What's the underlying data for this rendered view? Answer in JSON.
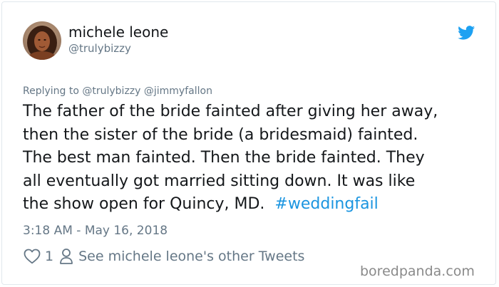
{
  "author": {
    "name": "michele leone",
    "handle": "@trulybizzy",
    "avatar": "profile-photo"
  },
  "icons": {
    "platform": "twitter-bird-icon",
    "like": "heart-icon",
    "profile": "person-icon"
  },
  "colors": {
    "twitter_blue": "#1da1f2",
    "hashtag": "#1b95e0",
    "secondary_text": "#657786",
    "primary_text": "#14171a"
  },
  "reply": {
    "text": "Replying to @trulybizzy @jimmyfallon"
  },
  "tweet": {
    "lines": [
      "The father of the bride fainted after giving her away,",
      "then the sister of the bride (a bridesmaid) fainted.",
      "The best man fainted.  Then the bride fainted.  They",
      "all eventually got married sitting down.  It was like"
    ],
    "last_line": "the show open for Quincy, MD.  ",
    "hashtag": "#weddingfail"
  },
  "timestamp": "3:18 AM - May 16, 2018",
  "actions": {
    "like_count": "1",
    "other_tweets_label": "See michele leone's other Tweets"
  },
  "watermark": "boredpanda.com"
}
